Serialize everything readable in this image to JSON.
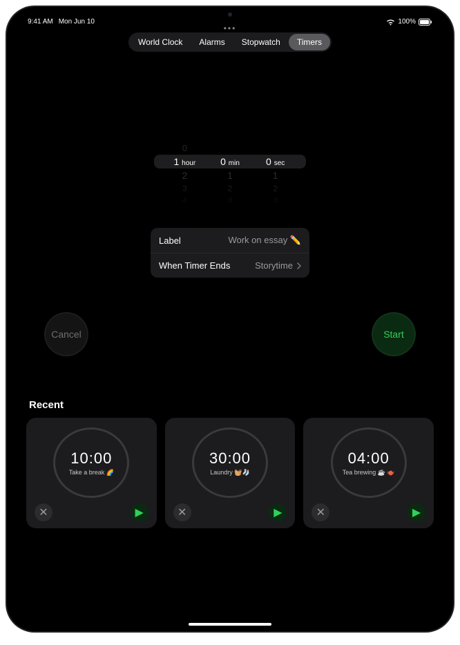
{
  "status": {
    "time": "9:41 AM",
    "date": "Mon Jun 10",
    "battery": "100%"
  },
  "tabs": [
    "World Clock",
    "Alarms",
    "Stopwatch",
    "Timers"
  ],
  "activeTab": "Timers",
  "picker": {
    "aboveHour": "0",
    "hourVal": "1",
    "hourUnit": "hour",
    "minVal": "0",
    "minUnit": "min",
    "secVal": "0",
    "secUnit": "sec",
    "row2": [
      "2",
      "1",
      "1"
    ],
    "row3": [
      "3",
      "2",
      "2"
    ],
    "row4": [
      "4",
      "3",
      "3"
    ]
  },
  "settings": {
    "labelKey": "Label",
    "labelVal": "Work on essay ✏️",
    "endKey": "When Timer Ends",
    "endVal": "Storytime"
  },
  "cancel": "Cancel",
  "start": "Start",
  "recentTitle": "Recent",
  "recents": [
    {
      "time": "10:00",
      "label": "Take a break 🌈"
    },
    {
      "time": "30:00",
      "label": "Laundry 🧺🧦"
    },
    {
      "time": "04:00",
      "label": "Tea brewing ☕️ 🫖"
    }
  ]
}
